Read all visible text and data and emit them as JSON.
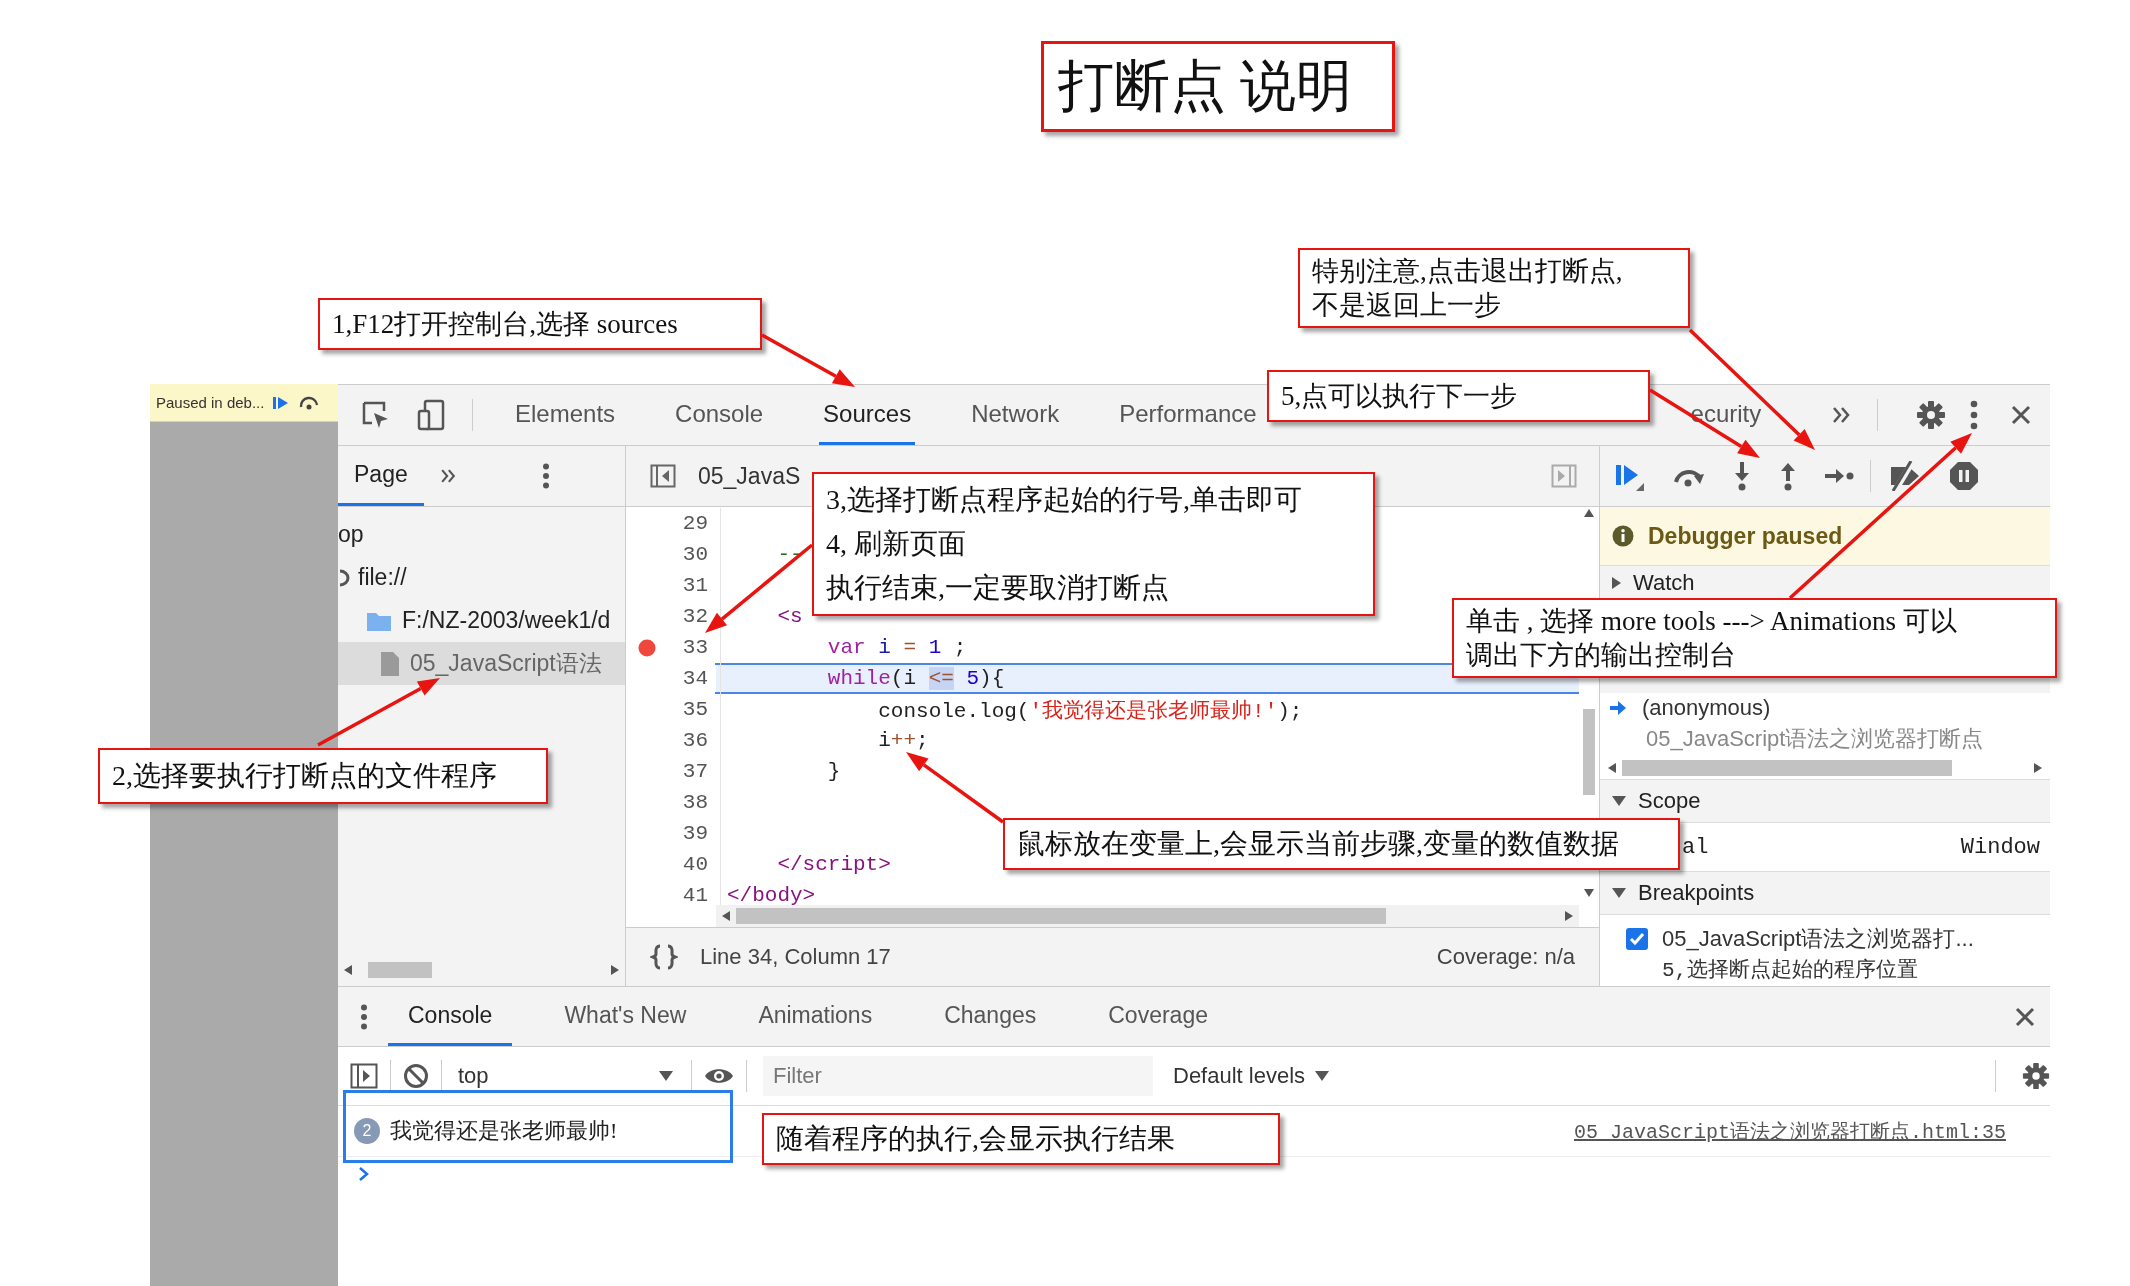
{
  "title": "打断点 说明",
  "paused_bar": {
    "text": "Paused in deb..."
  },
  "main_tabs": [
    {
      "label": "Elements",
      "selected": false
    },
    {
      "label": "Console",
      "selected": false
    },
    {
      "label": "Sources",
      "selected": true
    },
    {
      "label": "Network",
      "selected": false
    },
    {
      "label": "Performance",
      "selected": false
    },
    {
      "label": "ecurity",
      "selected": false
    }
  ],
  "navigator": {
    "tab": "Page",
    "tree": [
      {
        "label": "op",
        "selected": false,
        "children": [
          {
            "label": "file://",
            "kind": "origin",
            "selected": false,
            "children": [
              {
                "label": "F:/NZ-2003/week1/d",
                "kind": "folder",
                "selected": false,
                "children": [
                  {
                    "label": "05_JavaScript语法",
                    "kind": "file",
                    "selected": true
                  }
                ]
              }
            ]
          }
        ]
      }
    ]
  },
  "editor": {
    "file_tab": "05_JavaS",
    "lines": [
      {
        "number": "29",
        "breakpoint": false,
        "current": false
      },
      {
        "number": "30",
        "breakpoint": false,
        "current": false,
        "tokens": [
          {
            "text": "    --",
            "kind": "comment"
          }
        ]
      },
      {
        "number": "31",
        "breakpoint": false,
        "current": false
      },
      {
        "number": "32",
        "breakpoint": false,
        "current": false,
        "tokens": [
          {
            "text": "    <s",
            "kind": "tag"
          }
        ]
      },
      {
        "number": "33",
        "breakpoint": true,
        "current": false,
        "tokens": [
          {
            "text": "        var",
            "kind": "keyword"
          },
          {
            "text": " i ",
            "kind": "variable"
          },
          {
            "text": "=",
            "kind": "operator"
          },
          {
            "text": " 1",
            "kind": "number"
          },
          {
            "text": " ;",
            "kind": "plain"
          }
        ]
      },
      {
        "number": "34",
        "breakpoint": false,
        "current": true,
        "tokens": [
          {
            "text": "        while",
            "kind": "keyword"
          },
          {
            "text": "(i ",
            "kind": "plain"
          },
          {
            "text": "<=",
            "kind": "hover"
          },
          {
            "text": " 5",
            "kind": "number"
          },
          {
            "text": "){",
            "kind": "plain"
          }
        ]
      },
      {
        "number": "35",
        "breakpoint": false,
        "current": false,
        "tokens": [
          {
            "text": "            console.log(",
            "kind": "plain"
          },
          {
            "text": "'我觉得还是张老师最帅!'",
            "kind": "string"
          },
          {
            "text": ");",
            "kind": "plain"
          }
        ]
      },
      {
        "number": "36",
        "breakpoint": false,
        "current": false,
        "tokens": [
          {
            "text": "            i",
            "kind": "plain"
          },
          {
            "text": "++",
            "kind": "operator"
          },
          {
            "text": ";",
            "kind": "plain"
          }
        ]
      },
      {
        "number": "37",
        "breakpoint": false,
        "current": false,
        "tokens": [
          {
            "text": "        }",
            "kind": "plain"
          }
        ]
      },
      {
        "number": "38",
        "breakpoint": false,
        "current": false
      },
      {
        "number": "39",
        "breakpoint": false,
        "current": false
      },
      {
        "number": "40",
        "breakpoint": false,
        "current": false,
        "tokens": [
          {
            "text": "    </script>",
            "kind": "tag"
          }
        ]
      },
      {
        "number": "41",
        "breakpoint": false,
        "current": false,
        "tokens": [
          {
            "text": "</body>",
            "kind": "tag"
          }
        ]
      }
    ],
    "position": "Line 34, Column 17",
    "coverage": "Coverage: n/a"
  },
  "debugger": {
    "paused": "Debugger paused",
    "watch": {
      "label": "Watch",
      "expanded": false
    },
    "call_stack": [
      {
        "function": "(anonymous)",
        "location": "05_JavaScript语法之浏览器打断点",
        "current": true
      }
    ],
    "scope": {
      "label": "Scope",
      "expanded": true,
      "rows": [
        {
          "name": "al",
          "value": "Window"
        }
      ]
    },
    "breakpoints": {
      "label": "Breakpoints",
      "expanded": true,
      "items": [
        {
          "file": "05_JavaScript语法之浏览器打...",
          "code": "5,选择断点起始的程序位置",
          "checked": true
        }
      ]
    }
  },
  "drawer": {
    "tabs": [
      {
        "label": "Console",
        "selected": true
      },
      {
        "label": "What's New",
        "selected": false
      },
      {
        "label": "Animations",
        "selected": false
      },
      {
        "label": "Changes",
        "selected": false
      },
      {
        "label": "Coverage",
        "selected": false
      }
    ],
    "context": "top",
    "filter": {
      "placeholder": "Filter"
    },
    "levels": "Default levels",
    "messages": [
      {
        "count": "2",
        "text": "我觉得还是张老师最帅!",
        "source": "05_JavaScript语法之浏览器打断点.html:35"
      }
    ]
  },
  "callouts": [
    {
      "lines": [
        "特别注意,点击退出打断点,",
        "不是返回上一步"
      ]
    },
    {
      "lines": [
        "1,F12打开控制台,选择 sources"
      ]
    },
    {
      "lines": [
        "5,点可以执行下一步"
      ]
    },
    {
      "lines": [
        "3,选择打断点程序起始的行号,单击即可",
        "4, 刷新页面",
        "执行结束,一定要取消打断点"
      ]
    },
    {
      "lines": [
        "单击 , 选择 more tools ---> Animations 可以",
        "调出下方的输出控制台"
      ]
    },
    {
      "lines": [
        "2,选择要执行打断点的文件程序"
      ]
    },
    {
      "lines": [
        "鼠标放在变量上,会显示当前步骤,变量的数值数据"
      ]
    },
    {
      "lines": [
        "随着程序的执行,会显示执行结果"
      ]
    }
  ]
}
